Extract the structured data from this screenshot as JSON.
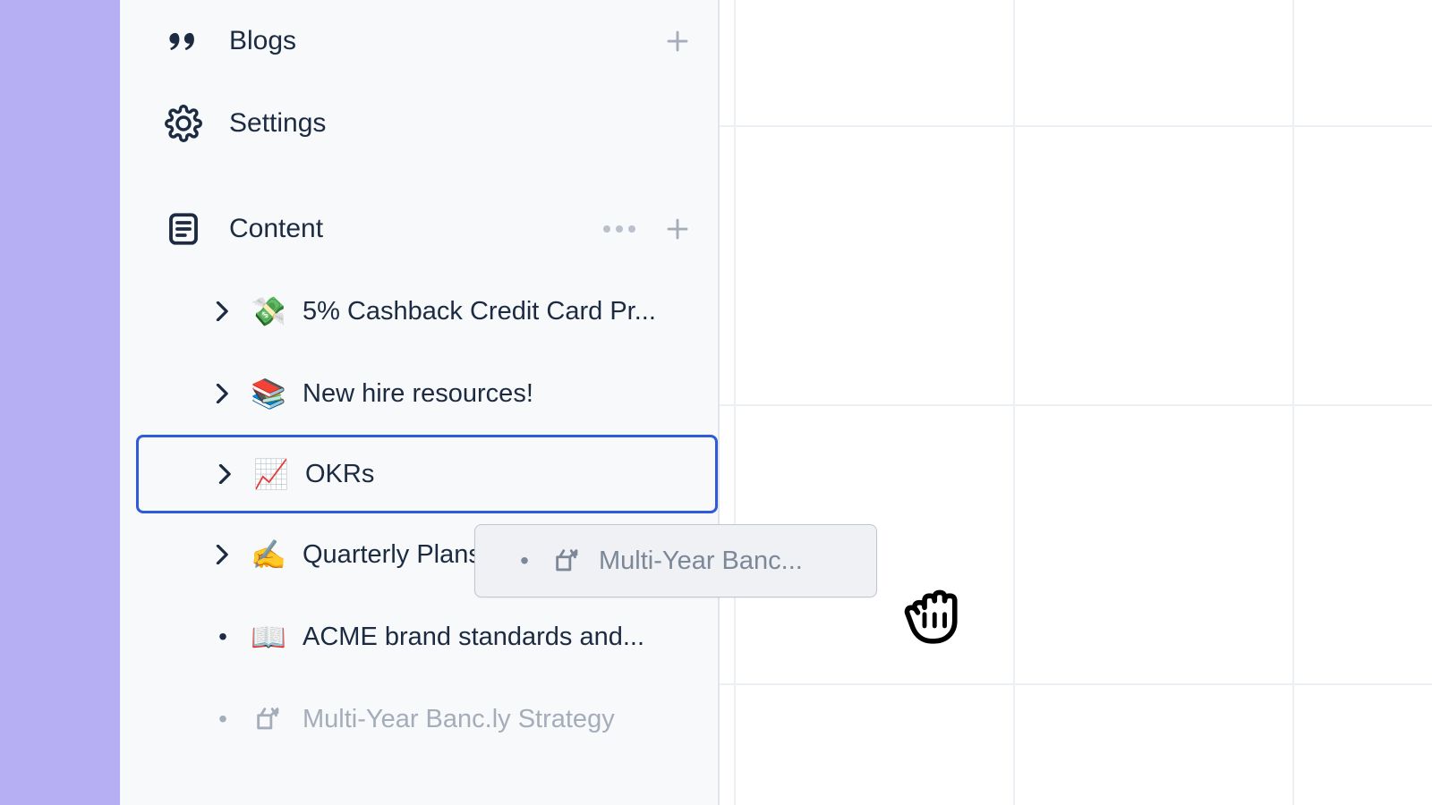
{
  "sidebar": {
    "nav": {
      "blogs": {
        "label": "Blogs"
      },
      "settings": {
        "label": "Settings"
      }
    },
    "section": {
      "label": "Content"
    },
    "tree": [
      {
        "emoji": "💸",
        "label": "5% Cashback Credit Card Pr..."
      },
      {
        "emoji": "📚",
        "label": "New hire resources!"
      },
      {
        "emoji": "📈",
        "label": "OKRs"
      },
      {
        "emoji": "✍️",
        "label": "Quarterly Plans"
      },
      {
        "emoji": "📖",
        "label": "ACME brand standards and..."
      },
      {
        "emoji": "whiteboard",
        "label": "Multi-Year Banc.ly Strategy"
      }
    ]
  },
  "drag": {
    "label": "Multi-Year Banc..."
  }
}
